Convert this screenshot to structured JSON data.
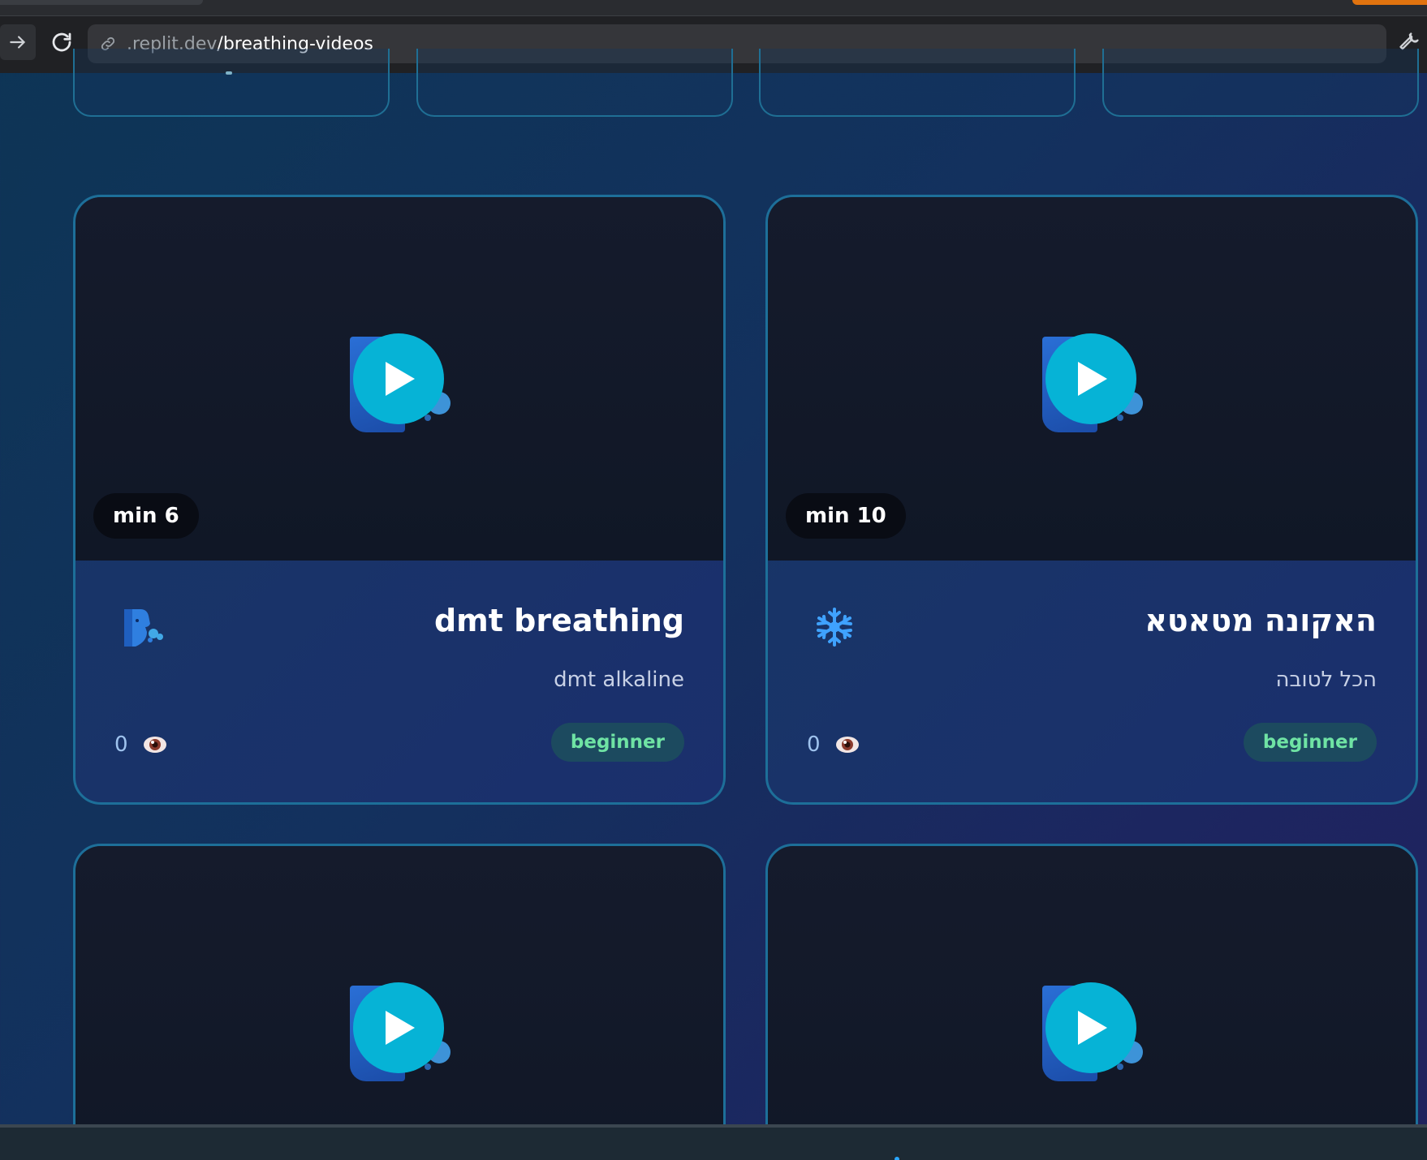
{
  "browser": {
    "url_host": ".replit.dev",
    "url_path": "/breathing-videos",
    "accent_color": "#e0730f"
  },
  "icons": {
    "forward": "arrow-right-icon",
    "reload": "reload-icon",
    "link": "link-icon",
    "wrench": "wrench-icon",
    "play": "play-icon",
    "views": "eye-icon"
  },
  "videos": [
    {
      "duration": "min 6",
      "title": "dmt breathing",
      "subtitle": "dmt alkaline",
      "views": "0",
      "level": "beginner",
      "category_icon": "breathing-face-icon"
    },
    {
      "duration": "min 10",
      "title": "האקונה מטאטא",
      "subtitle": "הכל לטובה",
      "views": "0",
      "level": "beginner",
      "category_icon": "snowflake-icon"
    }
  ],
  "colors": {
    "card_border": "#1d6f99",
    "play_button": "#06b3d6",
    "level_text": "#6fe3a4",
    "level_bg": "#1c4a5f"
  }
}
